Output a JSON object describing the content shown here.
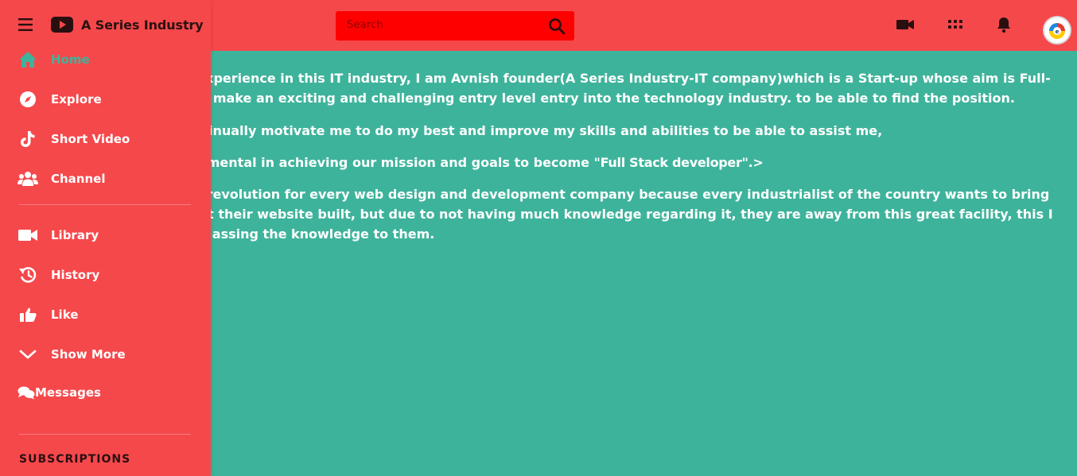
{
  "app": {
    "title": "A Series Industry"
  },
  "search": {
    "placeholder": "Search"
  },
  "colors": {
    "sidebar": "#f5484b",
    "content_bg": "#3eb39b",
    "search_bg": "#ff0000",
    "active": "#3eb39b"
  },
  "header_icons": [
    "video-camera-icon",
    "apps-grid-icon",
    "bell-icon"
  ],
  "sidebar": {
    "items": [
      {
        "label": "Home",
        "icon": "home-icon",
        "active": true
      },
      {
        "label": "Explore",
        "icon": "compass-icon"
      },
      {
        "label": "Short Video",
        "icon": "tiktok-icon"
      },
      {
        "label": "Channel",
        "icon": "users-icon"
      },
      {
        "label": "Library",
        "icon": "video-library-icon"
      },
      {
        "label": "History",
        "icon": "history-icon"
      },
      {
        "label": "Like",
        "icon": "thumbs-up-icon"
      },
      {
        "label": "Show More",
        "icon": "chevron-down-icon"
      },
      {
        "label": "Messages",
        "icon": "chat-bubbles-icon"
      }
    ],
    "subscriptions_heading": "SUBSCRIPTIONS"
  },
  "content": {
    "p1": "ars of experience in this IT industry, I am Avnish founder(A Series Industry-IT company)which is a Start-up whose aim is Full-stack to make an exciting and challenging entry level entry into the technology industry. to be able to find the position.",
    "p2": "vill continually motivate me to do my best and improve my skills and abilities to be able to assist me,",
    "p3_text": "e instrumental in achieving our mission and goals to become ",
    "p3_highlight": "\"Full Stack developer\".",
    "p3_suffix": ">",
    "p4": "bring a revolution for every web design and development company because every industrialist of the country wants to bring their get their website built, but due to not having much knowledge regarding it, they are away from this great facility, this I have an assing the knowledge to them."
  }
}
